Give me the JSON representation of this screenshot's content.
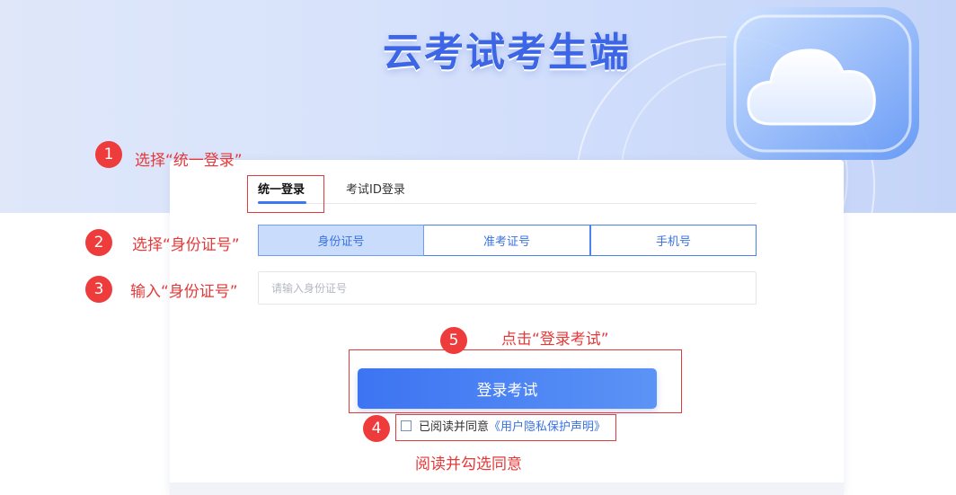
{
  "header": {
    "title": "云考试考生端"
  },
  "login_tabs": [
    {
      "label": "统一登录",
      "active": true
    },
    {
      "label": "考试ID登录",
      "active": false
    }
  ],
  "id_types": [
    {
      "label": "身份证号",
      "active": true
    },
    {
      "label": "准考证号",
      "active": false
    },
    {
      "label": "手机号",
      "active": false
    }
  ],
  "id_input": {
    "placeholder": "请输入身份证号",
    "value": ""
  },
  "login_button": {
    "label": "登录考试"
  },
  "agreement": {
    "checked": false,
    "text": "已阅读并同意",
    "link": "《用户隐私保护声明》"
  },
  "annotations": [
    {
      "number": "1",
      "label": "选择“统一登录”"
    },
    {
      "number": "2",
      "label": "选择“身份证号”"
    },
    {
      "number": "3",
      "label": "输入“身份证号”"
    },
    {
      "number": "4",
      "label": "阅读并勾选同意"
    },
    {
      "number": "5",
      "label": "点击“登录考试”"
    }
  ],
  "colors": {
    "accent": "#3a78f2",
    "annotation_red": "#ee3b3b",
    "active_type_bg": "#c9dcfc"
  }
}
